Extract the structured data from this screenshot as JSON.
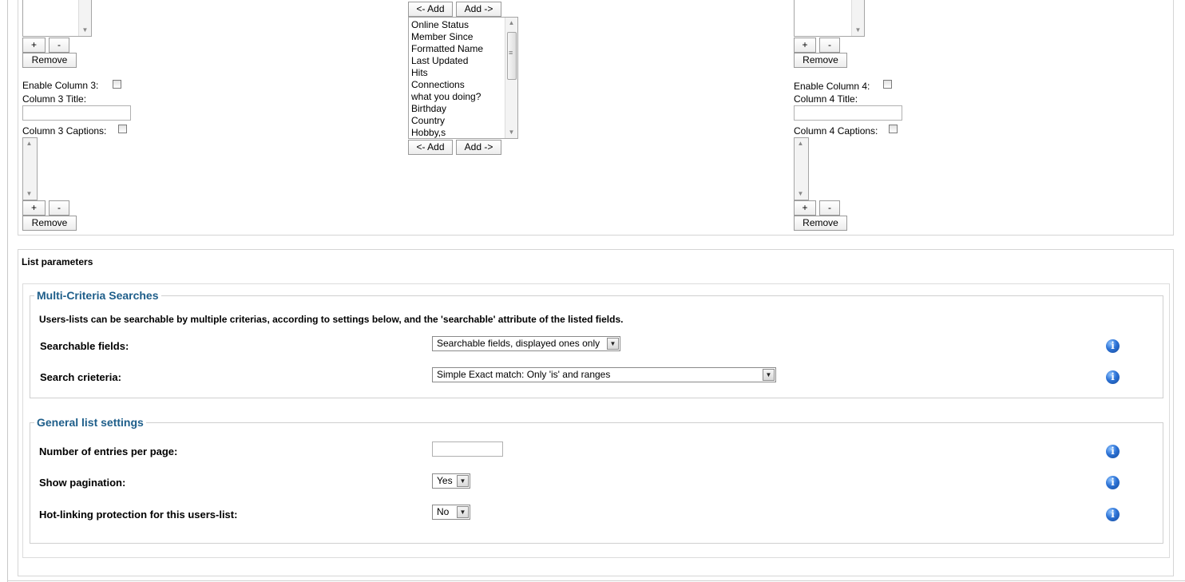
{
  "column1": {
    "plus": "+",
    "minus": "-",
    "remove": "Remove"
  },
  "column3": {
    "enable_label": "Enable Column 3:",
    "title_label": "Column 3 Title:",
    "title_value": "",
    "captions_label": "Column 3 Captions:",
    "plus": "+",
    "minus": "-",
    "remove": "Remove"
  },
  "fields_picker": {
    "add_left": "<- Add",
    "add_right": "Add ->",
    "fields": [
      "Online Status",
      "Member Since",
      "Formatted Name",
      "Last Updated",
      "Hits",
      "Connections",
      "what you doing?",
      "Birthday",
      "Country",
      "Hobby,s"
    ]
  },
  "column2": {
    "plus": "+",
    "minus": "-",
    "remove": "Remove"
  },
  "column4": {
    "enable_label": "Enable Column 4:",
    "title_label": "Column 4 Title:",
    "title_value": "",
    "captions_label": "Column 4 Captions:",
    "plus": "+",
    "minus": "-",
    "remove": "Remove"
  },
  "list_parameters": {
    "title": "List parameters",
    "multi_criteria": {
      "legend": "Multi-Criteria Searches",
      "description": "Users-lists can be searchable by multiple criterias, according to settings below, and the 'searchable' attribute of the listed fields.",
      "searchable_fields_label": "Searchable fields:",
      "searchable_fields_value": "Searchable fields, displayed ones only",
      "search_criteria_label": "Search crieteria:",
      "search_criteria_value": "Simple Exact match: Only 'is' and ranges"
    },
    "general": {
      "legend": "General list settings",
      "entries_label": "Number of entries per page:",
      "entries_value": "",
      "pagination_label": "Show pagination:",
      "pagination_value": "Yes",
      "hotlink_label": "Hot-linking protection for this users-list:",
      "hotlink_value": "No"
    }
  },
  "icons": {
    "info": "i",
    "info_color": "#2d73d6",
    "legend_color": "#1e5e8a"
  }
}
